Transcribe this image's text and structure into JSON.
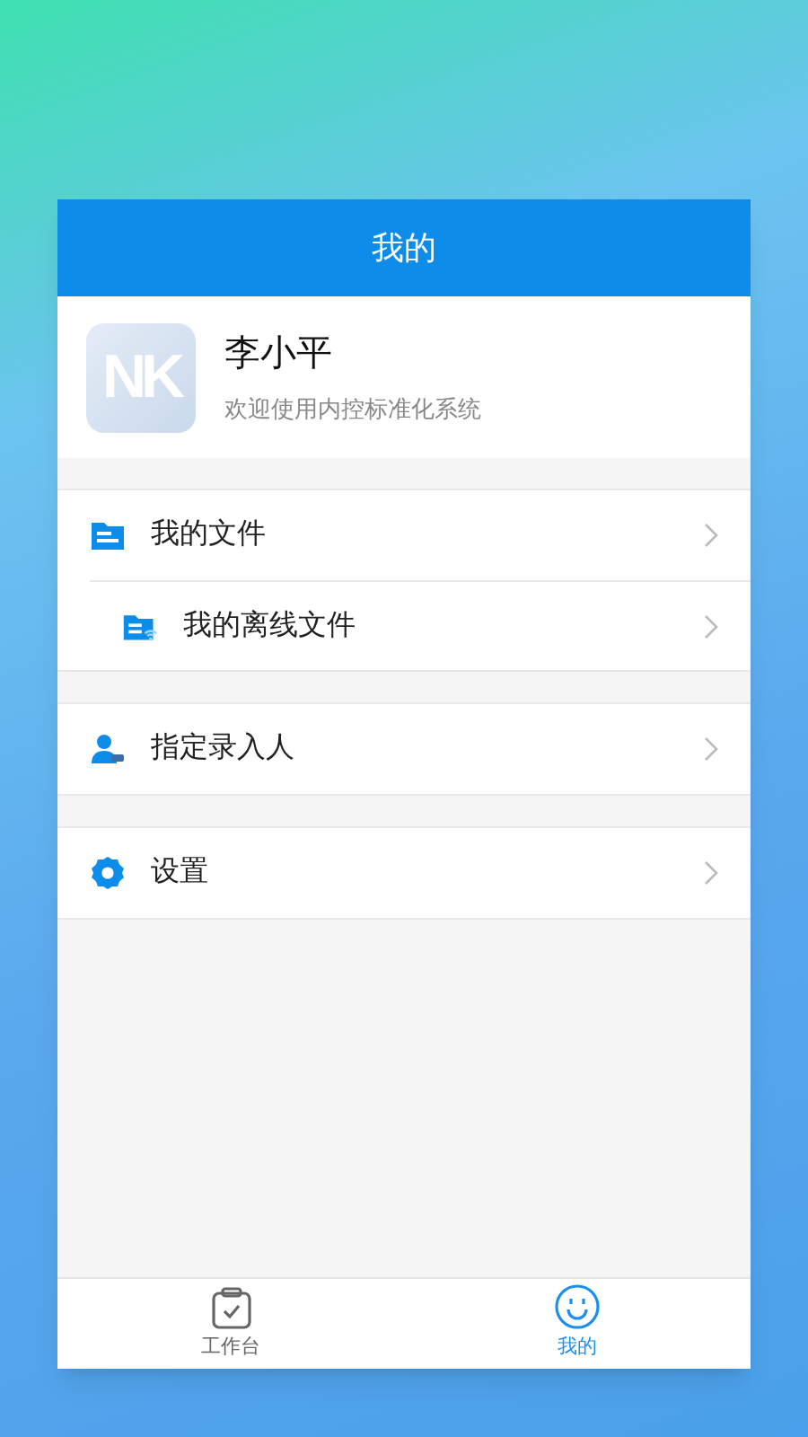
{
  "header": {
    "title": "我的"
  },
  "profile": {
    "logo": "NK",
    "name": "李小平",
    "subtitle": "欢迎使用内控标准化系统"
  },
  "groups": [
    {
      "items": [
        {
          "kind": "file",
          "label": "我的文件"
        },
        {
          "kind": "offline-file",
          "label": "我的离线文件"
        }
      ]
    },
    {
      "items": [
        {
          "kind": "person",
          "label": "指定录入人"
        }
      ]
    },
    {
      "items": [
        {
          "kind": "gear",
          "label": "设置"
        }
      ]
    }
  ],
  "tabs": [
    {
      "kind": "workbench",
      "label": "工作台",
      "selected": false
    },
    {
      "kind": "smile",
      "label": "我的",
      "selected": true
    }
  ]
}
